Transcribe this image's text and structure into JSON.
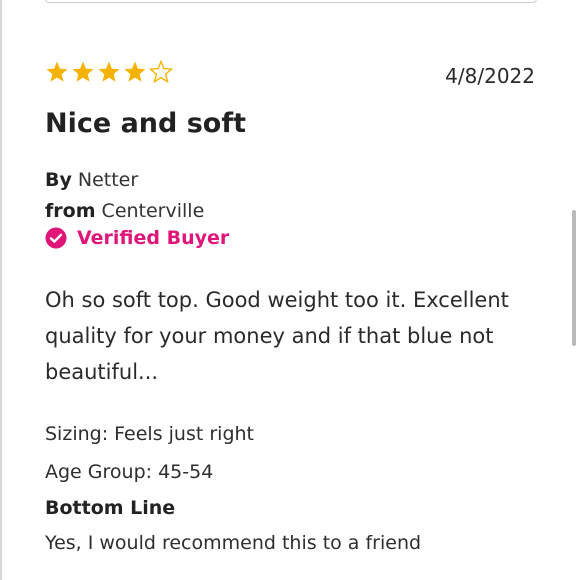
{
  "review": {
    "rating": 4,
    "rating_max": 5,
    "star_color": "#F5B301",
    "date": "4/8/2022",
    "title": "Nice and soft",
    "by_label": "By",
    "author": "Netter",
    "from_label": "from",
    "location": "Centerville",
    "verified_label": "Verified Buyer",
    "verified_color": "#E0157A",
    "body": "Oh so soft top. Good weight too it. Excellent quality for your money and if that blue not beautiful...",
    "sizing_label": "Sizing:",
    "sizing_value": "Feels just right",
    "age_label": "Age Group:",
    "age_value": "45-54",
    "bottom_line_label": "Bottom Line",
    "bottom_line_value": "Yes, I would recommend this to a friend"
  }
}
